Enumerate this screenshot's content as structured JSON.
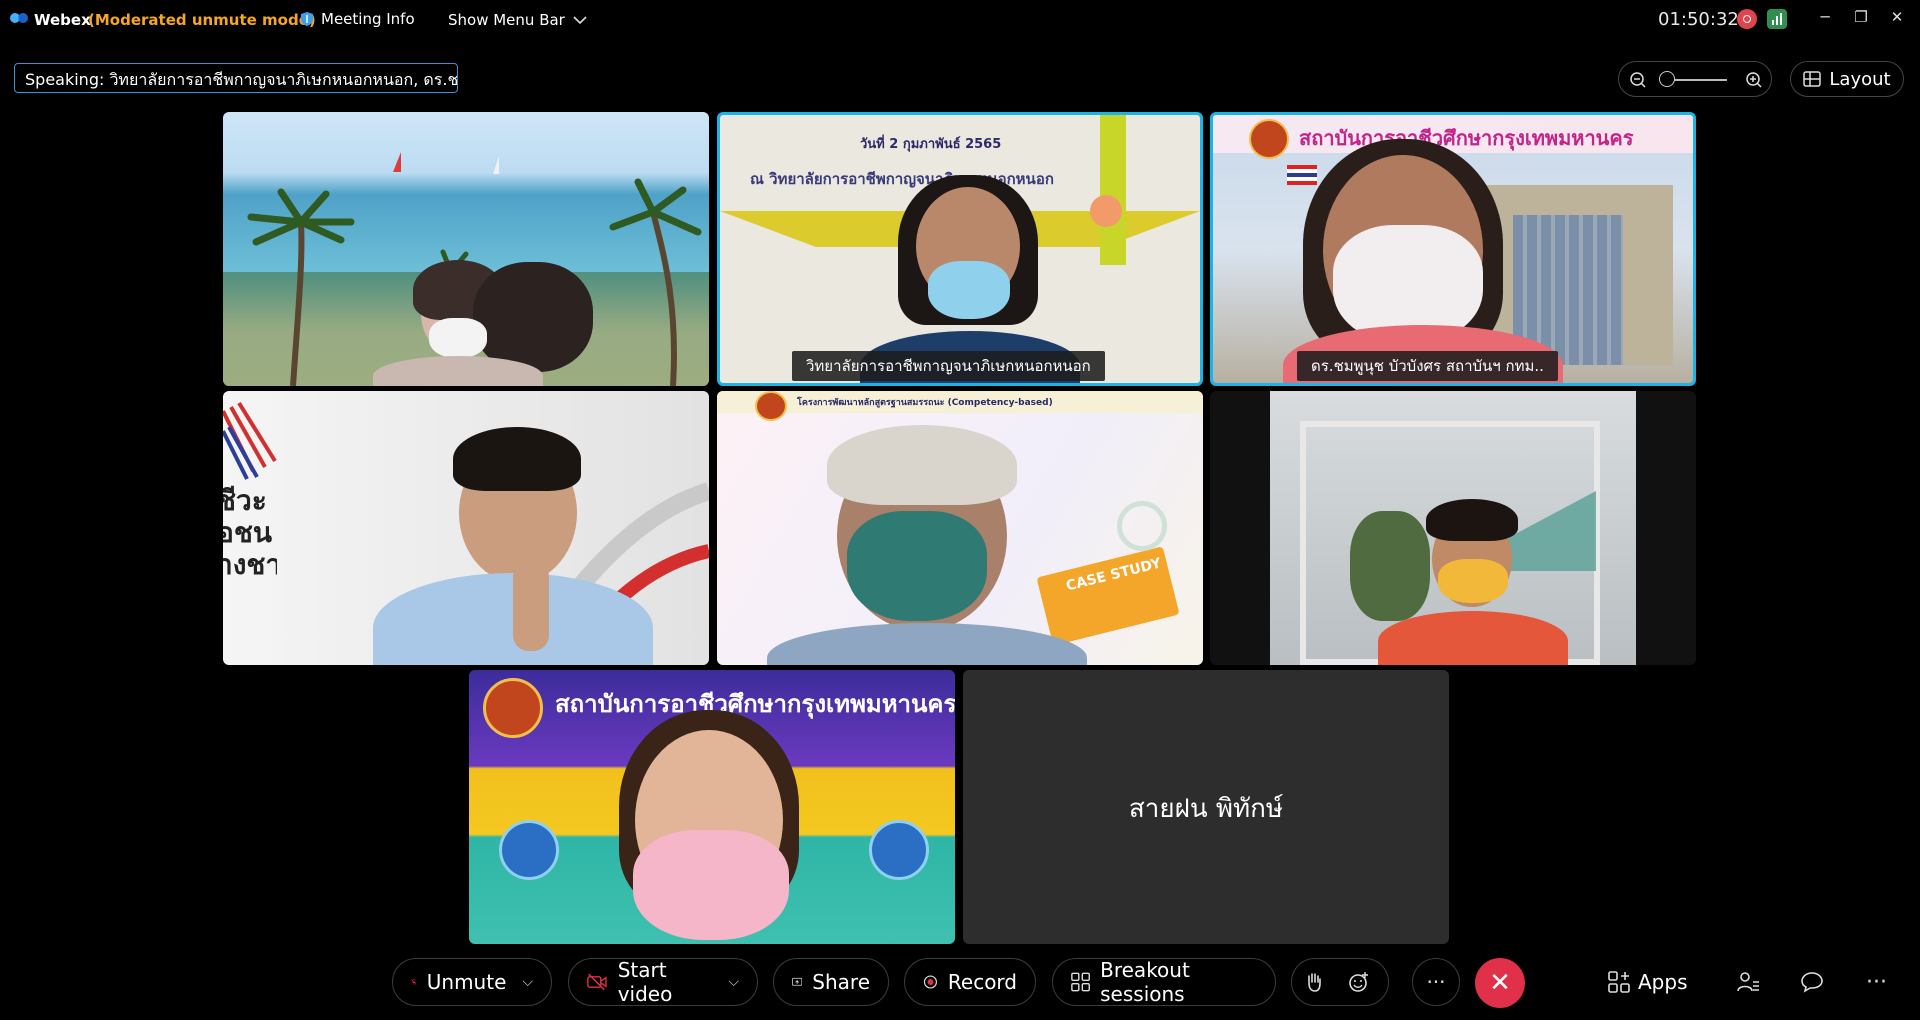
{
  "topbar": {
    "app_name": "Webex",
    "mode": "(Moderated unmute mode)",
    "meeting_info": "Meeting Info",
    "show_menu_bar": "Show Menu Bar",
    "clock": "01:50:32"
  },
  "speaking": "Speaking: วิทยาลัยการอาชีพกาญจนาภิเษกหนอกหนอก, ดร.ช...",
  "layout_label": "Layout",
  "tiles": {
    "t2_banner_date": "วันที่  2  กุมภาพันธ์   2565",
    "t2_banner_place": "ณ วิทยาลัยการอาชีพกาญจนาภิเษกหนอกหนอก",
    "t2_name": "วิทยาลัยการอาชีพกาญจนาภิเษกหนอกหนอก",
    "t3_banner": "สถาบันการอาชีวศึกษากรุงเทพมหานคร",
    "t3_name": "ดร.ชมพูนุช บัวบังศร สถาบันฯ กทม..",
    "t4_bg_text": "ชีวะ\nอชน\nางชาติ",
    "t5_banner": "โครงการพัฒนาหลักสูตรฐานสมรรถนะ (Competency-based)",
    "t5_book": "CASE STUDY",
    "t7_banner": "สถาบันการอาชีวศึกษากรุงเทพมหานคร",
    "t8_name": "สายฝน พิทักษ์"
  },
  "bottombar": {
    "unmute": "Unmute",
    "start_video": "Start video",
    "share": "Share",
    "record": "Record",
    "breakout": "Breakout sessions",
    "apps": "Apps"
  },
  "colors": {
    "accent": "#19b5e6",
    "mode": "#f5a623",
    "end_call": "#e0304a"
  }
}
